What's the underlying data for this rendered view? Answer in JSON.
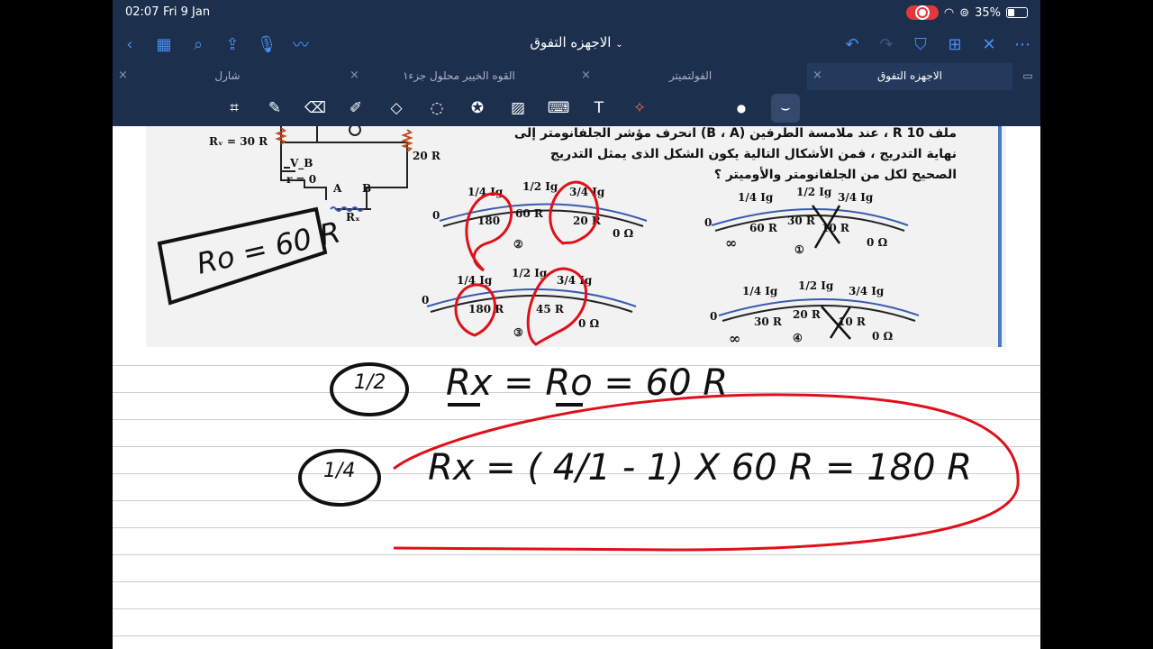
{
  "status": {
    "time": "02:07",
    "date": "Fri 9 Jan",
    "battery": "35%"
  },
  "nav": {
    "title": "الاجهزه  التفوق"
  },
  "tabs": [
    {
      "label": "شارل"
    },
    {
      "label": "القوه الخيير محلول جزء١"
    },
    {
      "label": "الفولتميتر"
    },
    {
      "label": "الاجهزه  التفوق"
    }
  ],
  "tools": [
    "lasso-scan",
    "pen",
    "eraser",
    "highlighter",
    "shapes",
    "lasso",
    "sticker",
    "image",
    "keyboard",
    "text",
    "laser-pointer",
    "dot",
    "stroke-style"
  ],
  "scan": {
    "line1": "ملف 10 R ، عند ملامسة الطرفين (B ، A) انحرف مؤشر الجلفانومتر إلى",
    "line2": "نهاية التدريج ، فمن الأشكال التالية يكون الشكل الذى يمثل التدريج",
    "line3": "الصحيح لكل من الجلفانومتر والأوميتر ؟",
    "circuit": {
      "rv": "Rᵥ = 30 R",
      "r20": "20 R",
      "vb": "V_B",
      "r0": "r = 0",
      "a": "A",
      "b": "B",
      "rx": "Rₓ"
    },
    "dials": [
      {
        "fracs": [
          "1/4 Ig",
          "1/2 Ig",
          "3/4 Ig"
        ],
        "r": [
          "180",
          "60 R",
          "20 R"
        ],
        "zero": "0",
        "ig": "Ig",
        "oΩ": "0 Ω",
        "mark": "②"
      },
      {
        "fracs": [
          "1/4 Ig",
          "1/2 Ig",
          "3/4 Ig"
        ],
        "r": [
          "60 R",
          "30 R",
          "10 R"
        ],
        "zero": "0",
        "ig": "Ig",
        "oΩ": "0 Ω",
        "inf": "∞",
        "mark": "①"
      },
      {
        "fracs": [
          "1/4 Ig",
          "1/2 Ig",
          "3/4 Ig"
        ],
        "r": [
          "180 R",
          "",
          "45 R"
        ],
        "zero": "0",
        "ig": "Ig",
        "oΩ": "0 Ω",
        "mark": "③"
      },
      {
        "fracs": [
          "1/4 Ig",
          "1/2 Ig",
          "3/4 Ig"
        ],
        "r": [
          "30 R",
          "20 R",
          "10 R"
        ],
        "zero": "0",
        "ig": "Ig",
        "oΩ": "0 Ω",
        "inf": "∞",
        "mark": "④"
      }
    ]
  },
  "notes": {
    "r0": "Ro = 60 R",
    "half": "1/2",
    "eq1": "Rx = Ro  =  60 R",
    "quarter": "1/4",
    "eq2": "Rx = ( 4/1 - 1) X 60 R = 180 R"
  },
  "colors": {
    "chrome": "#1c2f4d",
    "accent": "#4d8df0",
    "ink_red": "#e0101a"
  }
}
